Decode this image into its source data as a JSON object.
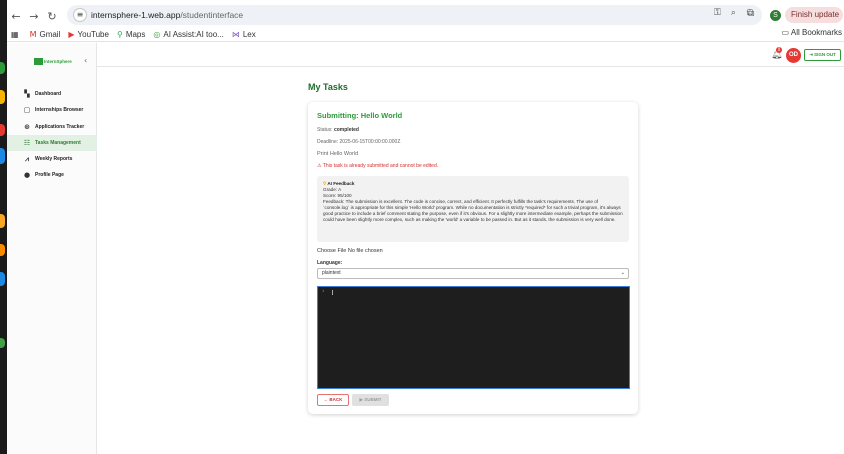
{
  "browser": {
    "url_host": "internsphere-1.web.app",
    "url_path": "/studentinterface",
    "finish_update_label": "Finish update",
    "profile_initial": "S",
    "bookmarks": [
      {
        "icon": "gmail-icon",
        "label": "Gmail"
      },
      {
        "icon": "youtube-icon",
        "label": "YouTube"
      },
      {
        "icon": "maps-icon",
        "label": "Maps"
      },
      {
        "icon": "ai-assist-icon",
        "label": "AI Assist:AI too..."
      },
      {
        "icon": "lex-icon",
        "label": "Lex"
      }
    ],
    "all_bookmarks_label": "All Bookmarks"
  },
  "app": {
    "logo_text": "InternSphere",
    "signout_label": "SIGN OUT",
    "avatar_initials": "OD",
    "notification_count": "0",
    "sidebar": {
      "items": [
        {
          "icon": "dashboard-icon",
          "label": "Dashboard",
          "active": false
        },
        {
          "icon": "briefcase-icon",
          "label": "Internships Browser",
          "active": false
        },
        {
          "icon": "applications-icon",
          "label": "Applications Tracker",
          "active": false
        },
        {
          "icon": "tasks-icon",
          "label": "Tasks Management",
          "active": true
        },
        {
          "icon": "chart-icon",
          "label": "Weekly Reports",
          "active": false
        },
        {
          "icon": "profile-icon",
          "label": "Profile Page",
          "active": false
        }
      ]
    },
    "page_title": "My Tasks",
    "task": {
      "title": "Submitting: Hello World",
      "status_label": "Status:",
      "status_value": "completed",
      "deadline": "Deadline: 2025-06-15T00:00:00.000Z",
      "description": "Print Hello World",
      "warning": "This task is already submitted and cannot be edited.",
      "feedback": {
        "heading": "AI Feedback",
        "grade": "Grade: A",
        "score": "Score: 95/100",
        "text": "Feedback: The submission is excellent. The code is concise, correct, and efficient. It perfectly fulfills the task's requirements. The use of `console.log` is appropriate for this simple 'Hello World' program. While no documentation is strictly *required* for such a trivial program, it's always good practice to include a brief comment stating the purpose, even if it's obvious. For a slightly more intermediate example, perhaps the submission could have been slightly more complex, such as making the 'world' a variable to be passed in. But as it stands, the submission is very well done."
      },
      "file_label": "Choose File No file chosen",
      "language_label": "Language:",
      "language_value": "plaintext",
      "editor_line": "1",
      "back_label": "BACK",
      "submit_label": "SUBMIT"
    }
  }
}
